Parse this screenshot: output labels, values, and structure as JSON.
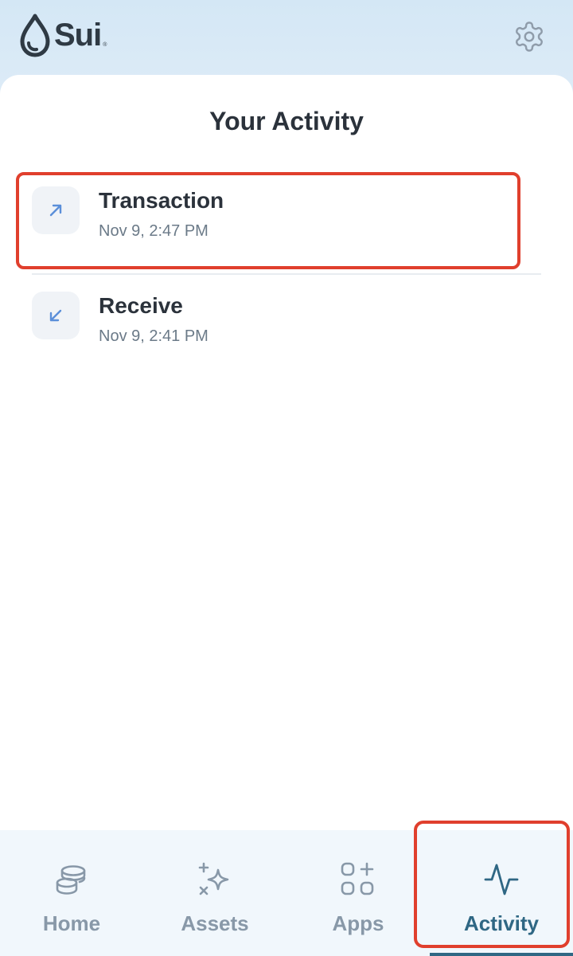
{
  "app": {
    "brand": "Sui",
    "trademark": "®"
  },
  "header": {
    "settings_icon": "gear-icon"
  },
  "page": {
    "title": "Your Activity"
  },
  "activities": [
    {
      "title": "Transaction",
      "time": "Nov 9, 2:47 PM",
      "icon": "arrow-up-right-icon",
      "highlighted": true
    },
    {
      "title": "Receive",
      "time": "Nov 9, 2:41 PM",
      "icon": "arrow-down-left-icon",
      "highlighted": false
    }
  ],
  "nav": {
    "items": [
      {
        "label": "Home",
        "icon": "coins-icon",
        "active": false
      },
      {
        "label": "Assets",
        "icon": "sparkles-icon",
        "active": false
      },
      {
        "label": "Apps",
        "icon": "apps-grid-icon",
        "active": false
      },
      {
        "label": "Activity",
        "icon": "pulse-icon",
        "active": true
      }
    ]
  },
  "colors": {
    "accent": "#2f6784",
    "highlight": "#e03f2d",
    "icon_blue": "#5b8fd9",
    "header_bg": "#d4e7f5"
  }
}
